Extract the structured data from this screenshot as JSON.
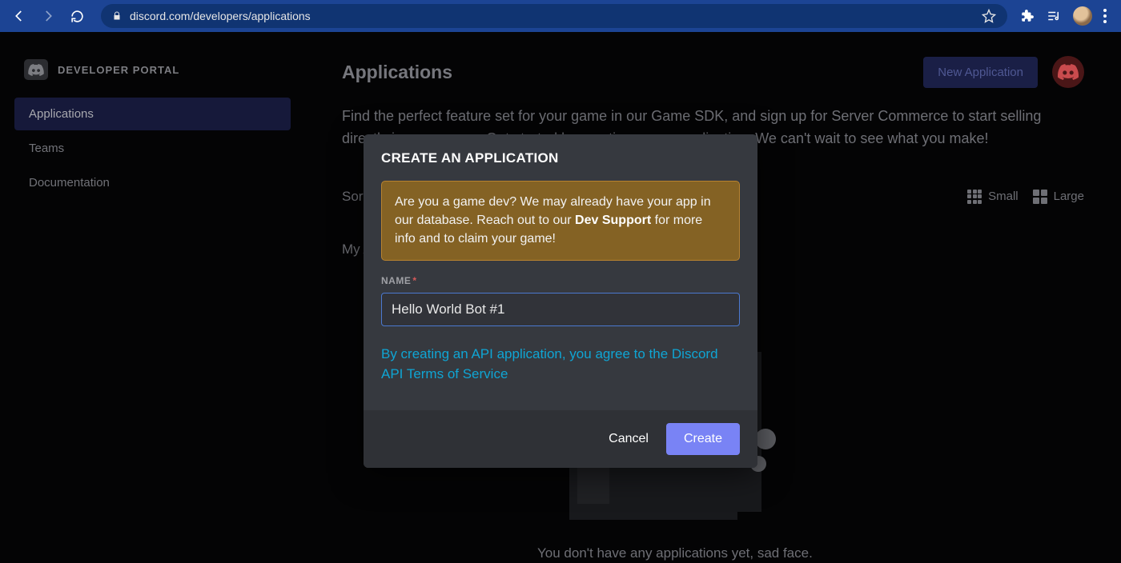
{
  "browser": {
    "url": "discord.com/developers/applications"
  },
  "sidebar": {
    "brand": "DEVELOPER PORTAL",
    "items": [
      {
        "label": "Applications",
        "active": true
      },
      {
        "label": "Teams",
        "active": false
      },
      {
        "label": "Documentation",
        "active": false
      }
    ]
  },
  "main": {
    "title": "Applications",
    "new_app_button": "New Application",
    "intro": "Find the perfect feature set for your game in our Game SDK, and sign up for Server Commerce to start selling directly in your server. Get started by creating a new application. We can't wait to see what you make!",
    "sort_label": "Sort By:",
    "view_small": "Small",
    "view_large": "Large",
    "my_apps_label": "My Applications",
    "empty_message": "You don't have any applications yet, sad face."
  },
  "modal": {
    "title": "CREATE AN APPLICATION",
    "callout_pre": "Are you a game dev? We may already have your app in our database. Reach out to our ",
    "callout_bold": "Dev Support",
    "callout_post": " for more info and to claim your game!",
    "name_label": "NAME",
    "name_value": "Hello World Bot #1",
    "tos_text": "By creating an API application, you agree to the Discord API Terms of Service",
    "cancel": "Cancel",
    "create": "Create"
  }
}
